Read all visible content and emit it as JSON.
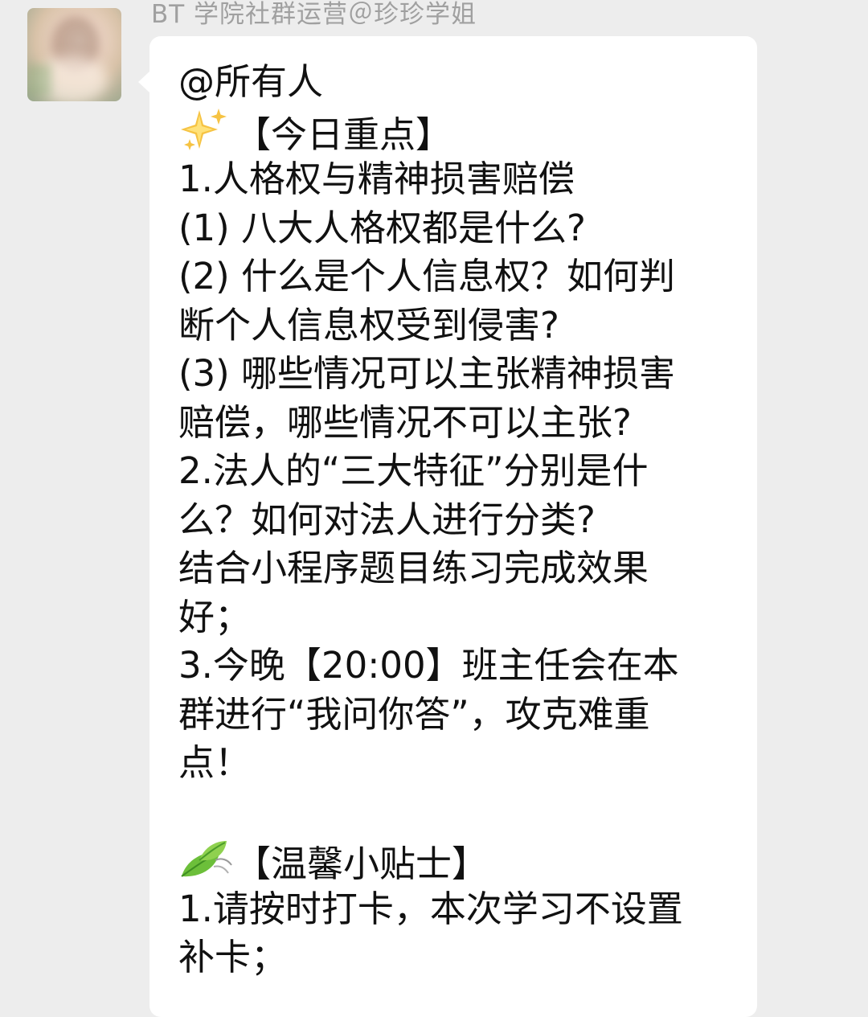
{
  "chat": {
    "sender": "BT 学院社群运营＠珍珍学姐",
    "message": {
      "mention": "@所有人",
      "key_points_header": "【今日重点】",
      "key_points_emoji": "sparkles-icon",
      "lines": [
        "1.人格权与精神损害赔偿",
        "(1) 八大人格权都是什么?",
        "(2) 什么是个人信息权？如何判",
        "断个人信息权受到侵害?",
        "(3) 哪些情况可以主张精神损害",
        "赔偿，哪些情况不可以主张?",
        "2.法人的“三大特征”分别是什",
        "么？如何对法人进行分类?",
        "结合小程序题目练习完成效果",
        "好；",
        "3.今晚【20:00】班主任会在本",
        "群进行“我问你答”，攻克难重",
        "点！"
      ],
      "tips_header": "【温馨小贴士】",
      "tips_emoji": "leaves-icon",
      "tips_lines": [
        "1.请按时打卡，本次学习不设置",
        "补卡；"
      ]
    }
  },
  "colors": {
    "background": "#ededed",
    "bubble": "#ffffff",
    "sender_name": "#a0a0a0",
    "text": "#111111"
  }
}
